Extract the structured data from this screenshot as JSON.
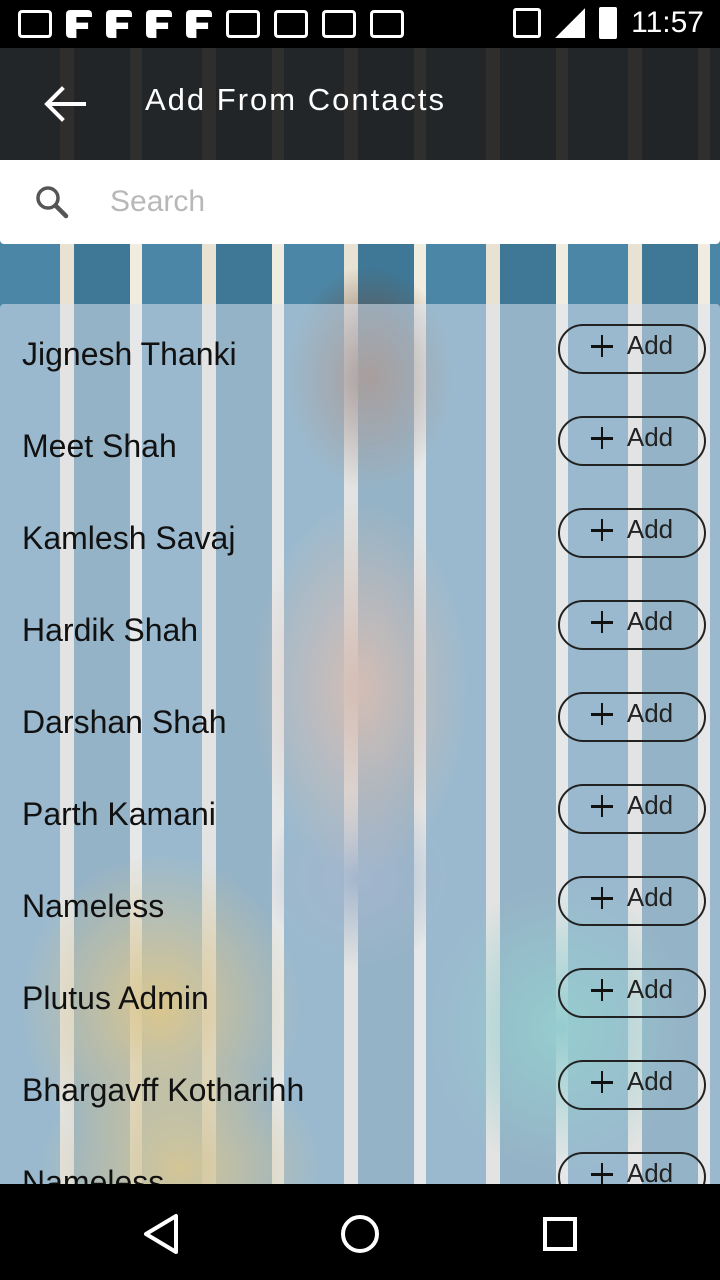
{
  "status_bar": {
    "time": "11:57"
  },
  "app_bar": {
    "title": "Add From Contacts",
    "back_icon": "arrow-left-icon"
  },
  "search": {
    "placeholder": "Search",
    "value": "",
    "icon": "search-icon"
  },
  "contacts": [
    {
      "name": "Jignesh Thanki",
      "button_label": "Add"
    },
    {
      "name": "Meet Shah",
      "button_label": "Add"
    },
    {
      "name": "Kamlesh Savaj",
      "button_label": "Add"
    },
    {
      "name": "Hardik Shah",
      "button_label": "Add"
    },
    {
      "name": "Darshan Shah",
      "button_label": "Add"
    },
    {
      "name": "Parth Kamani",
      "button_label": "Add"
    },
    {
      "name": "Nameless",
      "button_label": "Add"
    },
    {
      "name": "Plutus Admin",
      "button_label": "Add"
    },
    {
      "name": "Bhargavff Kotharihh",
      "button_label": "Add"
    },
    {
      "name": "Nameless",
      "button_label": "Add"
    }
  ],
  "nav_bar": {
    "back_icon": "triangle-back-icon",
    "home_icon": "circle-home-icon",
    "recents_icon": "square-recents-icon"
  },
  "colors": {
    "app_bar_bg": "#1e1e1e",
    "text_primary": "#111111",
    "button_border": "#222222"
  }
}
